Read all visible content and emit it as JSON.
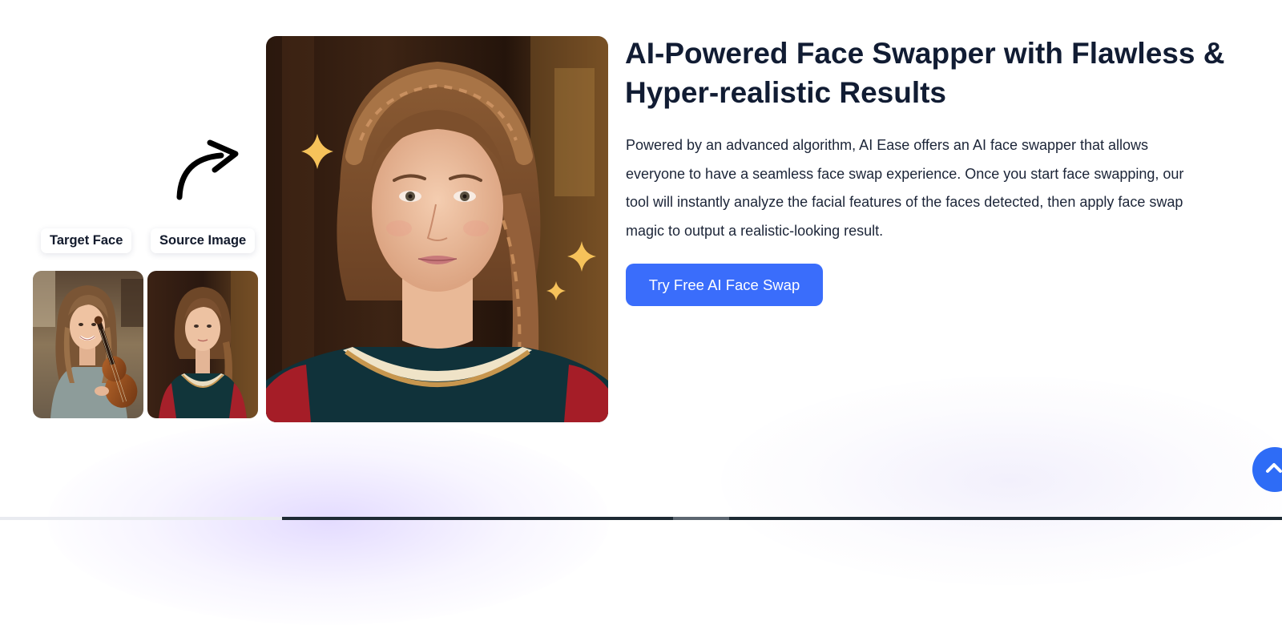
{
  "labels": {
    "target_face": "Target Face",
    "source_image": "Source Image"
  },
  "hero": {
    "headline": "AI-Powered Face Swapper with Flawless & Hyper-realistic Results",
    "description": "Powered by an advanced algorithm, AI Ease offers an AI face swapper that allows everyone to have a seamless face swap experience. Once you start face swapping, our tool will instantly analyze the facial features of the faces detected, then apply face swap magic to output a realistic-looking result.",
    "cta_label": "Try Free AI Face Swap"
  },
  "icons": {
    "arrow": "curved-arrow-icon",
    "sparkle": "sparkle-icon",
    "back_to_top": "chevron-up-icon"
  },
  "colors": {
    "accent": "#3a6dfb",
    "heading": "#111c33",
    "sparkle": "#f6c25a"
  }
}
